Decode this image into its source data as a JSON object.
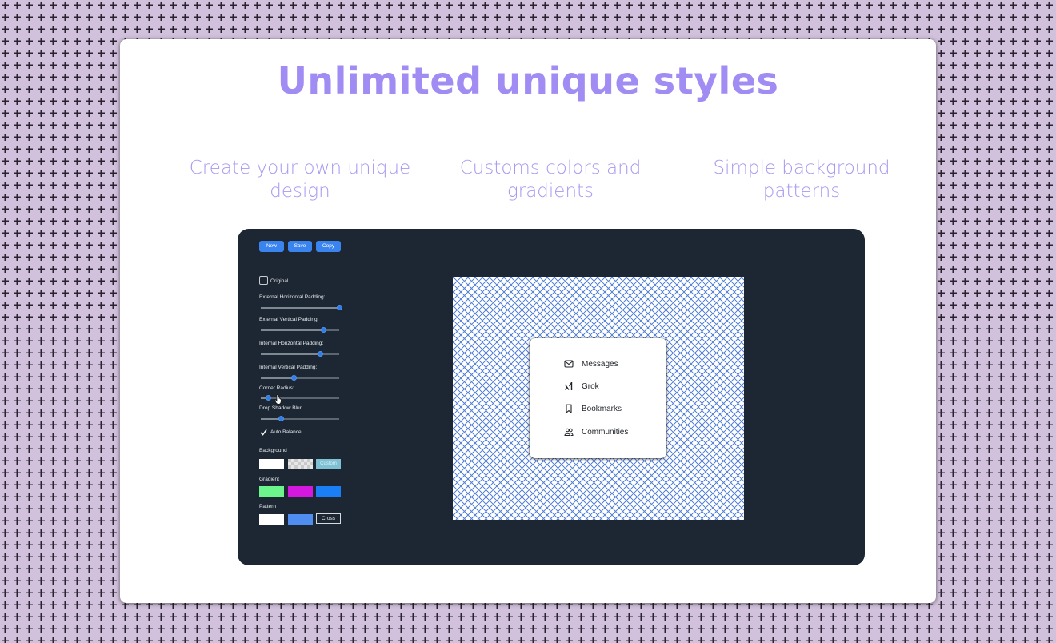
{
  "headline": "Unlimited unique styles",
  "features": [
    {
      "line1": "Create your own unique",
      "line2": "design"
    },
    {
      "line1": "Customs colors and",
      "line2": "gradients"
    },
    {
      "line1": "Simple background",
      "line2": "patterns"
    }
  ],
  "toolbar": {
    "new_label": "New",
    "save_label": "Save",
    "copy_label": "Copy"
  },
  "controls": {
    "original_label": "Original",
    "original_checked": false,
    "sliders": [
      {
        "label": "External Horizontal Padding:",
        "value": 1.0
      },
      {
        "label": "External Vertical Padding:",
        "value": 0.8
      },
      {
        "label": "Internal Horizontal Padding:",
        "value": 0.76
      },
      {
        "label": "Internal Vertical Padding:",
        "value": 0.42
      },
      {
        "label": "Corner Radius:",
        "value": 0.1
      },
      {
        "label": "Drop Shadow Blur:",
        "value": 0.26
      }
    ],
    "auto_balance_label": "Auto Balance",
    "auto_balance_checked": true
  },
  "background_section": {
    "label": "Background",
    "options": [
      {
        "name": "white",
        "color": "#ffffff"
      },
      {
        "name": "transparent",
        "color": "checker"
      },
      {
        "name": "custom",
        "label": "Custom",
        "color": "#7fc1d3"
      }
    ]
  },
  "gradient_section": {
    "label": "Gradient",
    "options": [
      {
        "name": "green",
        "color": "#6cf58a"
      },
      {
        "name": "magenta",
        "color": "#d418e0"
      },
      {
        "name": "blue",
        "color": "#1a7ff5"
      }
    ]
  },
  "pattern_section": {
    "label": "Pattern",
    "options": [
      {
        "name": "white",
        "color": "#ffffff"
      },
      {
        "name": "blue",
        "color": "#4f8ef0"
      },
      {
        "name": "cross",
        "label": "Cross",
        "color": "#1c2733"
      }
    ]
  },
  "preview_menu": {
    "items": [
      {
        "label": "Messages",
        "icon": "envelope-icon"
      },
      {
        "label": "Grok",
        "icon": "grok-icon"
      },
      {
        "label": "Bookmarks",
        "icon": "bookmark-icon"
      },
      {
        "label": "Communities",
        "icon": "people-icon"
      }
    ]
  },
  "colors": {
    "backdrop": "#d2c1dc",
    "accent": "#a08cf2",
    "panel": "#1c2733",
    "button": "#3a84f0",
    "pattern_cross": "#5b86d6"
  }
}
